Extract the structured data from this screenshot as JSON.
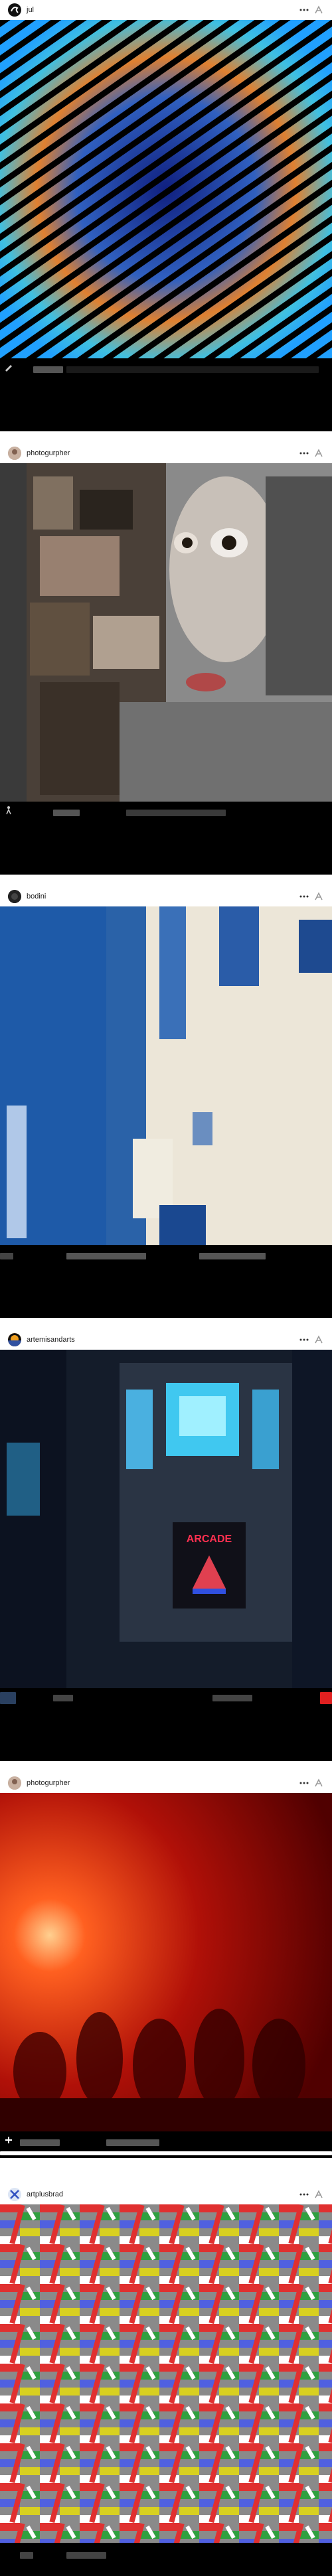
{
  "feed": {
    "posts": [
      {
        "username": "jul",
        "avatar_icon": "swirl-avatar-icon",
        "image_desc": "rainbow-wave-abstract"
      },
      {
        "username": "photogurpher",
        "avatar_icon": "photo-avatar-icon",
        "image_desc": "glitch-collage-face"
      },
      {
        "username": "bodini",
        "avatar_icon": "dark-avatar-icon",
        "image_desc": "blue-abstract-paint"
      },
      {
        "username": "artemisandarts",
        "avatar_icon": "sunset-avatar-icon",
        "image_desc": "arcade-night-street",
        "image_text": "ARCADE"
      },
      {
        "username": "photogurpher",
        "avatar_icon": "photo-avatar-icon",
        "image_desc": "red-fog-crowd"
      },
      {
        "username": "artplusbrad",
        "avatar_icon": "cross-avatar-icon",
        "image_desc": "colorful-pattern-tiles"
      }
    ]
  },
  "colors": {
    "accent_red": "#e02020",
    "footer_bg": "#000000"
  }
}
